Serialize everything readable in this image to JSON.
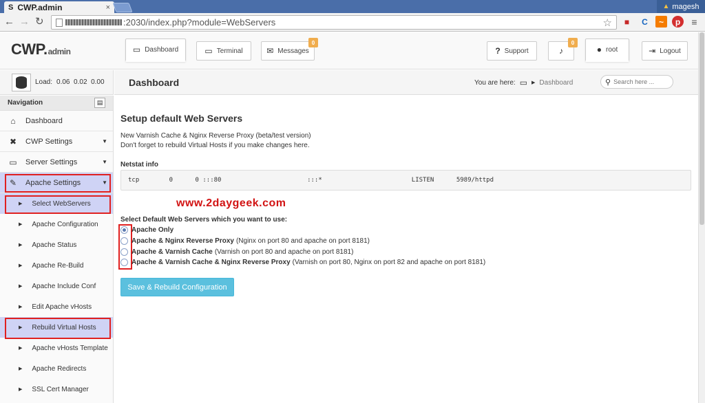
{
  "browser": {
    "tab_title": "CWP.admin",
    "tab_favicon": "S",
    "tab_close": "×",
    "user": "magesh",
    "url_visible": ":2030/index.php?module=WebServers"
  },
  "header": {
    "logo_main": "CWP.",
    "logo_sub": "admin",
    "dashboard_label": "Dashboard",
    "terminal_label": "Terminal",
    "messages_label": "Messages",
    "messages_badge": "0",
    "support_label": "Support",
    "notifications_badge": "0",
    "user_label": "root",
    "logout_label": "Logout"
  },
  "load": {
    "label": "Load:",
    "values": "0.06  0.02  0.00"
  },
  "page": {
    "title": "Dashboard",
    "breadcrumb_prefix": "You are here:",
    "breadcrumb_current": "Dashboard",
    "search_placeholder": "Search here ..."
  },
  "sidebar": {
    "heading": "Navigation",
    "items": [
      {
        "label": "Dashboard",
        "icon": "home-icon"
      },
      {
        "label": "CWP Settings",
        "icon": "wrench-icon"
      },
      {
        "label": "Server Settings",
        "icon": "monitor-icon"
      },
      {
        "label": "Apache Settings",
        "icon": "feather-icon"
      }
    ],
    "subitems": [
      "Select WebServers",
      "Apache Configuration",
      "Apache Status",
      "Apache Re-Build",
      "Apache Include Conf",
      "Edit Apache vHosts",
      "Rebuild Virtual Hosts",
      "Apache vHosts Template",
      "Apache Redirects",
      "SSL Cert Manager"
    ]
  },
  "main": {
    "heading": "Setup default Web Servers",
    "desc1": "New Varnish Cache & Nginx Reverse Proxy (beta/test version)",
    "desc2": "Don't forget to rebuild Virtual Hosts if you make changes here.",
    "netstat_label": "Netstat info",
    "netstat_line": "tcp        0      0 :::80                       :::*                        LISTEN      5989/httpd",
    "watermark": "www.2daygeek.com",
    "select_label": "Select Default Web Servers which you want to use:",
    "options": [
      {
        "bold": "Apache Only",
        "note": "",
        "selected": true
      },
      {
        "bold": "Apache & Nginx Reverse Proxy",
        "note": "(Nginx on port 80 and apache on port 8181)",
        "selected": false
      },
      {
        "bold": "Apache & Varnish Cache",
        "note": "(Varnish on port 80 and apache on port 8181)",
        "selected": false
      },
      {
        "bold": "Apache & Varnish Cache & Nginx Reverse Proxy",
        "note": "(Varnish on port 80, Nginx on port 82 and apache on port 8181)",
        "selected": false
      }
    ],
    "save_label": "Save & Rebuild Configuration"
  }
}
